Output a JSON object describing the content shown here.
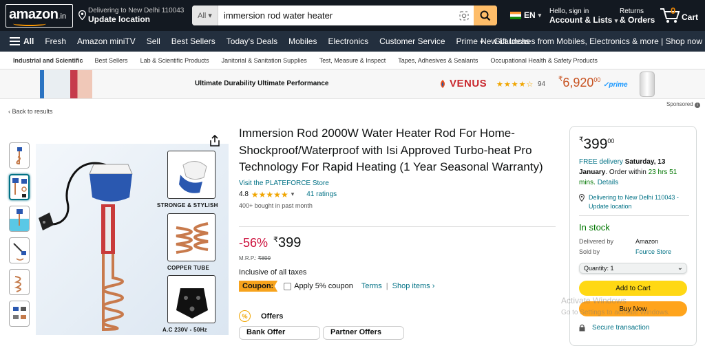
{
  "header": {
    "logo_text": "amazon",
    "logo_suffix": ".in",
    "deliver_line1": "Delivering to New Delhi 110043",
    "deliver_line2": "Update location",
    "search_category": "All",
    "search_query": "immersion rod water heater",
    "language": "EN",
    "account_line1": "Hello, sign in",
    "account_line2": "Account & Lists",
    "returns_line1": "Returns",
    "returns_line2": "& Orders",
    "cart_count": "0",
    "cart_label": "Cart"
  },
  "subnav": {
    "all_label": "All",
    "items": [
      "Fresh",
      "Amazon miniTV",
      "Sell",
      "Best Sellers",
      "Today's Deals",
      "Mobiles",
      "Electronics",
      "Customer Service",
      "Prime",
      "Gift Ideas"
    ],
    "promo": "New Launches from Mobiles, Electronics & more | Shop now"
  },
  "category_bar": {
    "items": [
      "Industrial and Scientific",
      "Best Sellers",
      "Lab & Scientific Products",
      "Janitorial & Sanitation Supplies",
      "Test, Measure & Inspect",
      "Tapes, Adhesives & Sealants",
      "Occupational Health & Safety Products"
    ]
  },
  "ad_banner": {
    "tagline": "Ultimate Durability Ultimate Performance",
    "brand": "VENUS",
    "rating_count": "94",
    "price_symbol": "₹",
    "price": "6,920",
    "price_fraction": "00",
    "prime_label": "prime"
  },
  "breadcrumb": {
    "back_label": "‹ Back to results"
  },
  "sponsored_label": "Sponsored",
  "gallery": {
    "thumb_count": 6,
    "selected_thumb": 2,
    "features": [
      {
        "label": "STRONGE & STYLISH"
      },
      {
        "label": "COPPER TUBE"
      },
      {
        "label": "A.C 230V - 50Hz"
      }
    ]
  },
  "product": {
    "title": "Immersion Rod 2000W Water Heater Rod For Home-Shockproof/Waterproof with Isi Approved Turbo-heat Pro Technology For Rapid Heating (1 Year Seasonal Warranty)",
    "store_link": "Visit the PLATEFORCE Store",
    "rating_value": "4.8",
    "rating_stars": 4.8,
    "ratings_count": "41 ratings",
    "bought": "400+ bought in past month",
    "discount": "-56%",
    "price_symbol": "₹",
    "price": "399",
    "mrp_label": "M.R.P.:",
    "mrp": "₹899",
    "taxes": "Inclusive of all taxes",
    "coupon_tag": "Coupon:",
    "coupon_text": "Apply 5% coupon",
    "terms_link": "Terms",
    "shop_items_link": "Shop items ›",
    "offers_label": "Offers",
    "offer_cards": [
      "Bank Offer",
      "Partner Offers"
    ]
  },
  "buybox": {
    "price_symbol": "₹",
    "price": "399",
    "price_fraction": "00",
    "free_delivery": "FREE delivery",
    "delivery_date": "Saturday, 13 January",
    "order_within_prefix": ". Order within",
    "order_within_time": "23 hrs 51 mins.",
    "details_link": "Details",
    "location": "Delivering to New Delhi 110043 - Update location",
    "stock": "In stock",
    "delivered_by_label": "Delivered by",
    "delivered_by_value": "Amazon",
    "sold_by_label": "Sold by",
    "sold_by_value": "Fource Store",
    "quantity_label": "Quantity: 1",
    "add_to_cart": "Add to Cart",
    "buy_now": "Buy Now",
    "secure": "Secure transaction"
  },
  "watermark": {
    "line1": "Activate Windows",
    "line2": "Go to Settings to activate Windows."
  },
  "colors": {
    "nav_bg": "#131921",
    "subnav_bg": "#232f3e",
    "search_button": "#febd69",
    "link": "#007185",
    "deal_red": "#cc0c39",
    "add_to_cart": "#ffd814",
    "buy_now": "#ffa41c",
    "in_stock": "#007600"
  }
}
